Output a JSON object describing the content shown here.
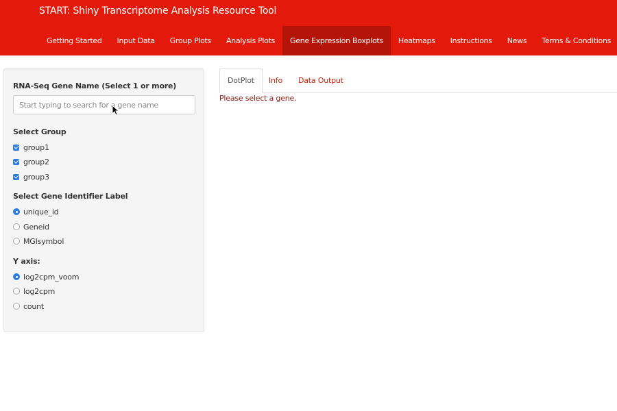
{
  "app": {
    "title": "START: Shiny Transcriptome Analysis Resource Tool"
  },
  "nav": {
    "items": [
      {
        "label": "Getting Started"
      },
      {
        "label": "Input Data"
      },
      {
        "label": "Group Plots"
      },
      {
        "label": "Analysis Plots"
      },
      {
        "label": "Gene Expression Boxplots",
        "active": true
      },
      {
        "label": "Heatmaps"
      },
      {
        "label": "Instructions"
      },
      {
        "label": "News"
      },
      {
        "label": "Terms & Conditions"
      }
    ]
  },
  "sidebar": {
    "gene_label": "RNA-Seq Gene Name (Select 1 or more)",
    "gene_placeholder": "Start typing to search for a gene name",
    "group_label": "Select Group",
    "groups": [
      {
        "label": "group1",
        "checked": true
      },
      {
        "label": "group2",
        "checked": true
      },
      {
        "label": "group3",
        "checked": true
      }
    ],
    "identifier_label": "Select Gene Identifier Label",
    "identifiers": [
      {
        "label": "unique_id",
        "selected": true
      },
      {
        "label": "Geneid",
        "selected": false
      },
      {
        "label": "MGIsymbol",
        "selected": false
      }
    ],
    "yaxis_label": "Y axis:",
    "yaxis_options": [
      {
        "label": "log2cpm_voom",
        "selected": true
      },
      {
        "label": "log2cpm",
        "selected": false
      },
      {
        "label": "count",
        "selected": false
      }
    ]
  },
  "main": {
    "tabs": [
      {
        "label": "DotPlot",
        "active": true
      },
      {
        "label": "Info"
      },
      {
        "label": "Data Output"
      }
    ],
    "message": "Please select a gene."
  },
  "colors": {
    "navbar": "#e31a0b",
    "nav_active": "#b51408",
    "accent": "#2f7de1",
    "tab_link": "#c0250d"
  }
}
